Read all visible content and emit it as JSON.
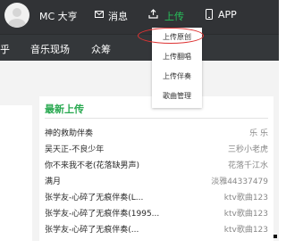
{
  "header": {
    "username": "MC 大亨",
    "nav": {
      "messages_label": "消息",
      "upload_label": "上传",
      "app_label": "APP"
    }
  },
  "subnav": {
    "partial_label": "乎",
    "items": [
      {
        "label": "音乐现场"
      },
      {
        "label": "众筹"
      }
    ]
  },
  "dropdown": {
    "items": [
      {
        "label": "上传原创"
      },
      {
        "label": "上传翻唱"
      },
      {
        "label": "上传伴奏"
      },
      {
        "label": "歌曲管理"
      }
    ]
  },
  "latest_uploads": {
    "title": "最新上传",
    "rows": [
      {
        "song": "神的救助伴奏",
        "artist": "乐 乐"
      },
      {
        "song": "吴天正-不良少年",
        "artist": "三秒小老虎"
      },
      {
        "song": "你不来我不老(花落缺男声)",
        "artist": "花落千江水"
      },
      {
        "song": "满月",
        "artist": "淡雅44337479"
      },
      {
        "song": "张学友-心碎了无痕伴奏(L...",
        "artist": "ktv歌曲123"
      },
      {
        "song": "张学友-心碎了无痕伴奏(1995...",
        "artist": "ktv歌曲123"
      },
      {
        "song": "张学友-心碎了无痕伴奏(...",
        "artist": "ktv歌曲123"
      }
    ]
  },
  "colors": {
    "topbar": "#313336",
    "accent": "#27c25a",
    "highlight": "#dd3333"
  }
}
